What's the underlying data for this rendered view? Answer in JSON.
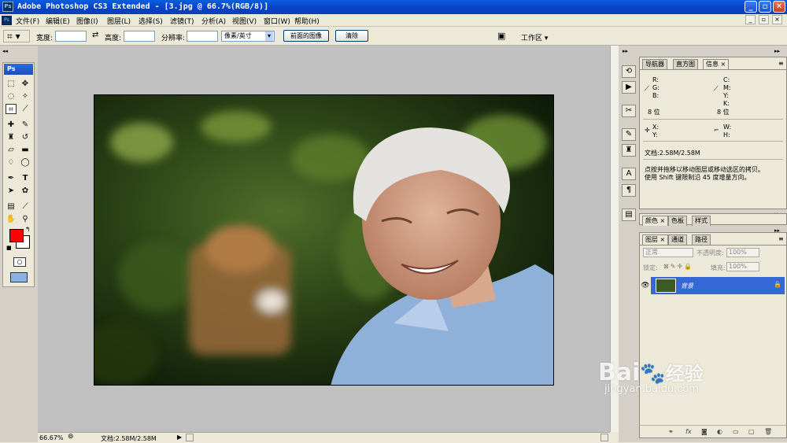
{
  "titlebar": {
    "title": "Adobe Photoshop CS3 Extended - [3.jpg @ 66.7%(RGB/8)]",
    "icon": "Ps",
    "min": "_",
    "max": "▫",
    "close": "✕"
  },
  "menu": {
    "items": [
      "文件(F)",
      "编辑(E)",
      "图像(I)",
      "图层(L)",
      "选择(S)",
      "滤镜(T)",
      "分析(A)",
      "视图(V)",
      "窗口(W)",
      "帮助(H)"
    ]
  },
  "options": {
    "width_label": "宽度:",
    "width_value": "",
    "height_label": "高度:",
    "height_value": "",
    "res_label": "分辨率:",
    "res_value": "",
    "unit": "像素/英寸",
    "front_image_button": "前面的图像",
    "clear_button": "清除",
    "workspace_label": "工作区 ▾"
  },
  "toolbox": {
    "header": "Ps"
  },
  "status": {
    "zoom": "66.67%",
    "doc": "文档:2.58M/2.58M"
  },
  "info_panel": {
    "tabs": [
      "导航器",
      "直方图",
      "信息 ×"
    ],
    "rgb": [
      "R:",
      "G:",
      "B:"
    ],
    "cmyk": [
      "C:",
      "M:",
      "Y:",
      "K:"
    ],
    "bits_left": "8 位",
    "bits_right": "8 位",
    "xy": [
      "X:",
      "Y:"
    ],
    "wh": [
      "W:",
      "H:"
    ],
    "doc": "文档:2.58M/2.58M",
    "hint1": "点按并拖移以移动图层或移动选区的拷贝。",
    "hint2": "使用 Shift 键限制沿 45 度增量方向。"
  },
  "color_panel": {
    "tabs": [
      "颜色 ×",
      "色板",
      "样式"
    ]
  },
  "layers_panel": {
    "tabs": [
      "图层 ×",
      "通道",
      "路径"
    ],
    "blend": "正常",
    "opacity_label": "不透明度:",
    "opacity": "100%",
    "lock_label": "锁定:",
    "fill_label": "填充:",
    "fill": "100%",
    "layer_name": "背景"
  },
  "watermark": {
    "brand": "Bai",
    "cn": "经验",
    "url": "jingyan.baidu.com"
  },
  "colors": {
    "foreground": "#ff0000",
    "background": "#ffffff",
    "layer_selected": "#3568d4"
  }
}
